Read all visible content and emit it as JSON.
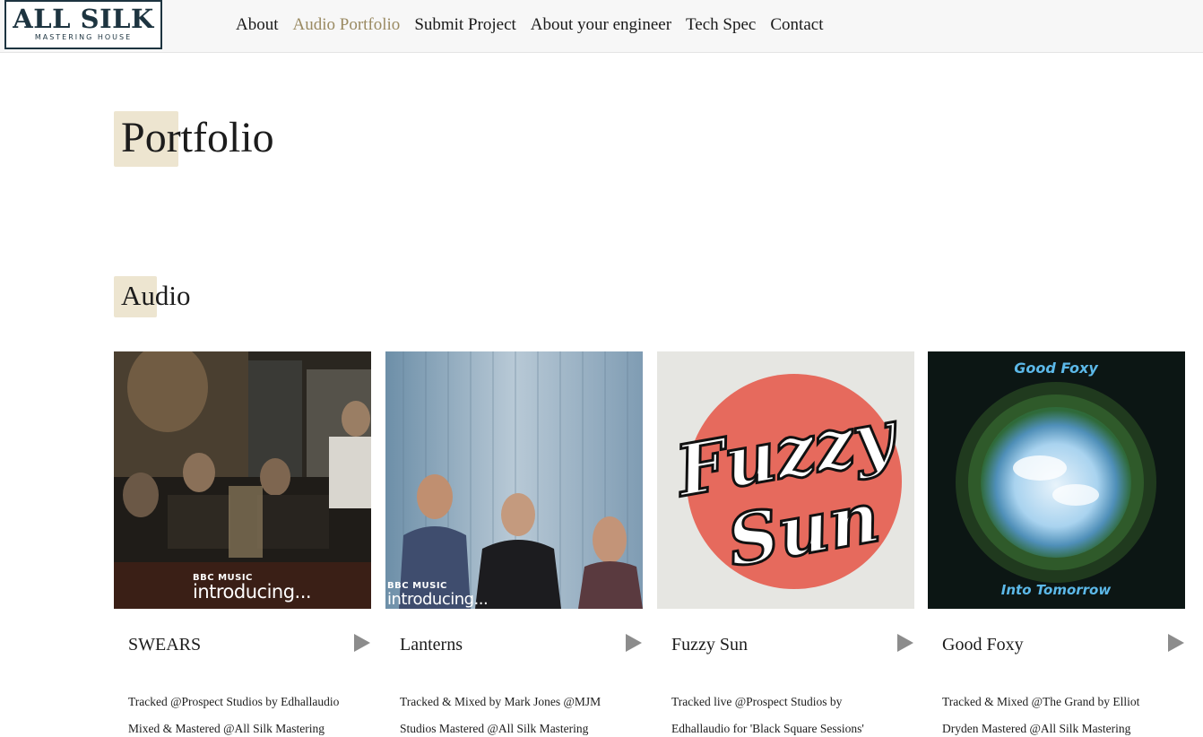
{
  "brand": {
    "name": "ALL SILK",
    "tagline": "MASTERING HOUSE"
  },
  "nav": [
    {
      "label": "About"
    },
    {
      "label": "Audio Portfolio"
    },
    {
      "label": "Submit Project"
    },
    {
      "label": "About your engineer"
    },
    {
      "label": "Tech Spec"
    },
    {
      "label": "Contact"
    }
  ],
  "active_nav": "Audio Portfolio",
  "page": {
    "title": "Portfolio",
    "section": "Audio"
  },
  "colors": {
    "accent": "#9a8a62",
    "highlight": "#ede5d0",
    "logo": "#1d3440",
    "play": "#8c8c8c"
  },
  "cards": [
    {
      "title": "SWEARS",
      "artwork_text": {
        "bbc": "BBC MUSIC",
        "intro": "introducing..."
      },
      "credits": [
        "Tracked @Prospect Studios by Edhallaudio",
        "Mixed & Mastered @All Silk Mastering"
      ],
      "icon": "play-icon"
    },
    {
      "title": "Lanterns",
      "artwork_text": {
        "bbc": "BBC MUSIC",
        "intro": "introducing..."
      },
      "credits": [
        "Tracked & Mixed by Mark Jones @MJM",
        "Studios Mastered @All Silk Mastering"
      ],
      "icon": "play-icon"
    },
    {
      "title": "Fuzzy Sun",
      "artwork_text": {
        "line1": "Fuzzy",
        "line2": "Sun"
      },
      "credits": [
        "Tracked live @Prospect Studios by",
        "Edhallaudio for 'Black Square Sessions'"
      ],
      "icon": "play-icon"
    },
    {
      "title": "Good Foxy",
      "artwork_text": {
        "top": "Good Foxy",
        "bottom": "Into Tomorrow"
      },
      "credits": [
        "Tracked & Mixed @The Grand by Elliot",
        "Dryden Mastered @All Silk Mastering"
      ],
      "icon": "play-icon"
    }
  ]
}
